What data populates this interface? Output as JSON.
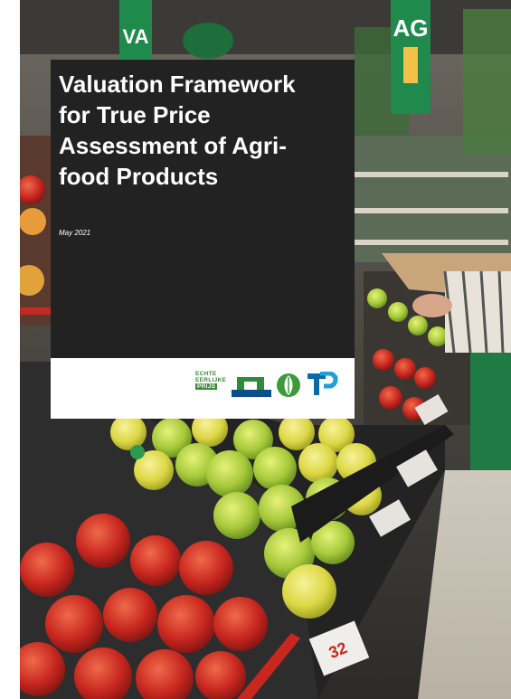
{
  "document": {
    "title": "Valuation Framework\nfor True Price\nAssessment of Agri-\nfood Products",
    "date": "May 2021"
  },
  "logos": {
    "echte": [
      "ECHTE",
      "EERLIJKE",
      "PRIJS"
    ],
    "others": [
      "bridge-logo",
      "leaf-logo",
      "tp-logo"
    ]
  },
  "photo": {
    "signs": [
      "VA",
      "AG"
    ],
    "price_tag": "32"
  },
  "colors": {
    "panel": "#222222",
    "title_text": "#ffffff",
    "brand_green": "#2e8b3a",
    "brand_blue": "#0b6aa8"
  }
}
